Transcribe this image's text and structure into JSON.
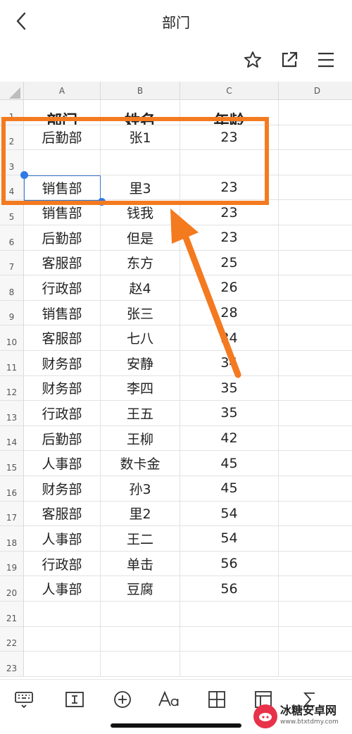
{
  "header": {
    "title": "部门",
    "back_icon": "chevron-left-icon",
    "actions": [
      "star-icon",
      "share-icon",
      "menu-icon"
    ]
  },
  "sheet": {
    "columns": [
      "A",
      "B",
      "C",
      "D"
    ],
    "header_row": {
      "row": "1",
      "cells": [
        "部门",
        "姓名",
        "年龄"
      ]
    },
    "rows": [
      {
        "row": "2",
        "cells": [
          "后勤部",
          "张1",
          "23"
        ]
      },
      {
        "row": "3",
        "cells": [
          "",
          "",
          ""
        ]
      },
      {
        "row": "4",
        "cells": [
          "销售部",
          "里3",
          "23"
        ]
      },
      {
        "row": "5",
        "cells": [
          "销售部",
          "钱我",
          "23"
        ]
      },
      {
        "row": "6",
        "cells": [
          "后勤部",
          "但是",
          "23"
        ]
      },
      {
        "row": "7",
        "cells": [
          "客服部",
          "东方",
          "25"
        ]
      },
      {
        "row": "8",
        "cells": [
          "行政部",
          "赵4",
          "26"
        ]
      },
      {
        "row": "9",
        "cells": [
          "销售部",
          "张三",
          "28"
        ]
      },
      {
        "row": "10",
        "cells": [
          "客服部",
          "七八",
          "34"
        ]
      },
      {
        "row": "11",
        "cells": [
          "财务部",
          "安静",
          "34"
        ]
      },
      {
        "row": "12",
        "cells": [
          "财务部",
          "李四",
          "35"
        ]
      },
      {
        "row": "13",
        "cells": [
          "行政部",
          "王五",
          "35"
        ]
      },
      {
        "row": "14",
        "cells": [
          "后勤部",
          "王柳",
          "42"
        ]
      },
      {
        "row": "15",
        "cells": [
          "人事部",
          "数卡金",
          "45"
        ]
      },
      {
        "row": "16",
        "cells": [
          "财务部",
          "孙3",
          "45"
        ]
      },
      {
        "row": "17",
        "cells": [
          "客服部",
          "里2",
          "54"
        ]
      },
      {
        "row": "18",
        "cells": [
          "人事部",
          "王二",
          "54"
        ]
      },
      {
        "row": "19",
        "cells": [
          "行政部",
          "单击",
          "56"
        ]
      },
      {
        "row": "20",
        "cells": [
          "人事部",
          "豆腐",
          "56"
        ]
      },
      {
        "row": "21",
        "cells": [
          "",
          "",
          ""
        ]
      },
      {
        "row": "22",
        "cells": [
          "",
          "",
          ""
        ]
      },
      {
        "row": "23",
        "cells": [
          "",
          "",
          ""
        ]
      }
    ],
    "selected_cell": "A4"
  },
  "annotation": {
    "highlight_color": "#f47a20"
  },
  "toolbar": {
    "tools": [
      "keyboard-icon",
      "text-cursor-icon",
      "insert-plus-icon",
      "font-format-icon",
      "table-grid-icon",
      "freeze-pane-icon",
      "sum-icon"
    ]
  },
  "watermark": {
    "name": "冰糖安卓网",
    "url": "www.btxtdmy.com"
  },
  "colors": {
    "accent": "#2f7ae5",
    "annotation": "#f47a20"
  }
}
